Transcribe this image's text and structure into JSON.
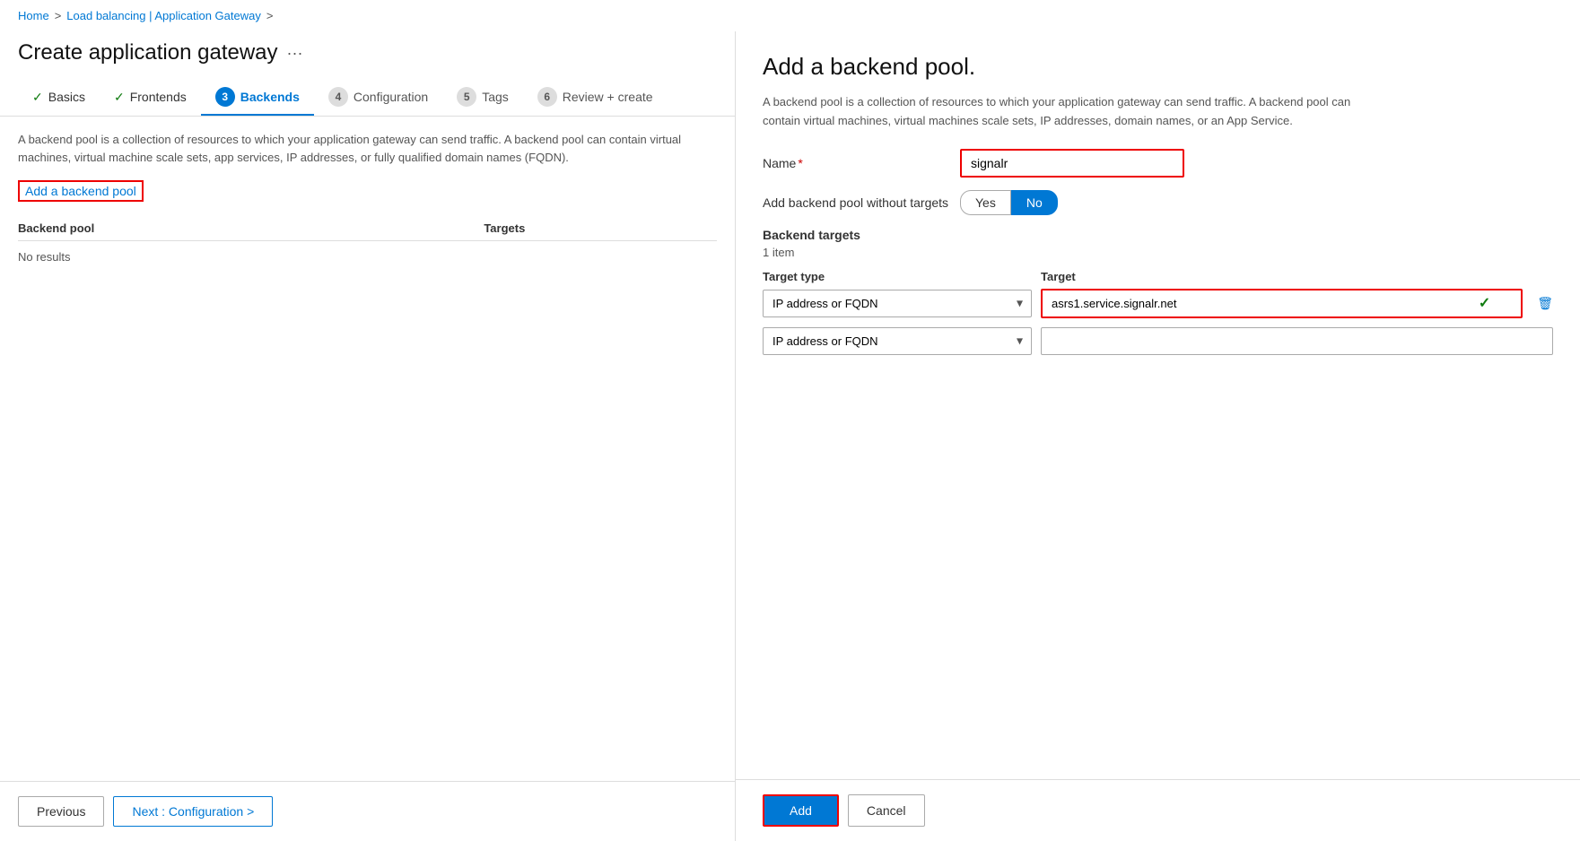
{
  "breadcrumb": {
    "home": "Home",
    "sep1": ">",
    "loadbalancing": "Load balancing | Application Gateway",
    "sep2": ">"
  },
  "page": {
    "title": "Create application gateway",
    "ellipsis": "···"
  },
  "wizard": {
    "tabs": [
      {
        "id": "basics",
        "label": "Basics",
        "state": "done",
        "number": null
      },
      {
        "id": "frontends",
        "label": "Frontends",
        "state": "done",
        "number": null
      },
      {
        "id": "backends",
        "label": "Backends",
        "state": "active",
        "number": "3"
      },
      {
        "id": "configuration",
        "label": "Configuration",
        "state": "inactive",
        "number": "4"
      },
      {
        "id": "tags",
        "label": "Tags",
        "state": "inactive",
        "number": "5"
      },
      {
        "id": "review",
        "label": "Review + create",
        "state": "inactive",
        "number": "6"
      }
    ]
  },
  "left": {
    "description": "A backend pool is a collection of resources to which your application gateway can send traffic. A backend pool can contain virtual machines, virtual machine scale sets, app services, IP addresses, or fully qualified domain names (FQDN).",
    "add_pool_link": "Add a backend pool",
    "table": {
      "col_pool": "Backend pool",
      "col_targets": "Targets"
    },
    "no_results": "No results"
  },
  "footer": {
    "previous": "Previous",
    "next": "Next : Configuration >"
  },
  "right": {
    "title": "Add a backend pool.",
    "description": "A backend pool is a collection of resources to which your application gateway can send traffic. A backend pool can contain virtual machines, virtual machines scale sets, IP addresses, domain names, or an App Service.",
    "name_label": "Name",
    "required_marker": "*",
    "name_value": "signalr",
    "toggle_label": "Add backend pool without targets",
    "toggle_yes": "Yes",
    "toggle_no": "No",
    "toggle_active": "No",
    "backend_targets_label": "Backend targets",
    "item_count": "1 item",
    "target_type_header": "Target type",
    "target_header": "Target",
    "rows": [
      {
        "type": "IP address or FQDN",
        "target": "asrs1.service.signalr.net",
        "has_check": true,
        "has_border": true
      },
      {
        "type": "IP address or FQDN",
        "target": "",
        "has_check": false,
        "has_border": false
      }
    ],
    "add_button": "Add",
    "cancel_button": "Cancel"
  }
}
